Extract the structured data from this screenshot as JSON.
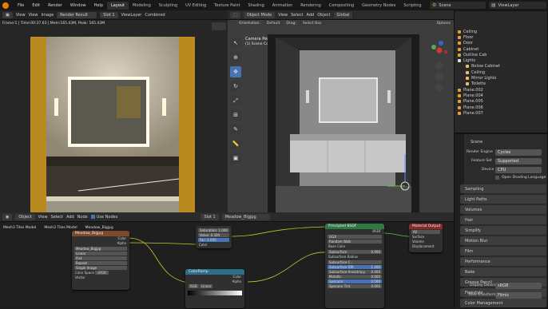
{
  "menu": [
    "File",
    "Edit",
    "Render",
    "Window",
    "Help"
  ],
  "workspaces": [
    "Layout",
    "Modeling",
    "Sculpting",
    "UV Editing",
    "Texture Paint",
    "Shading",
    "Animation",
    "Rendering",
    "Compositing",
    "Geometry Nodes",
    "Scripting"
  ],
  "active_workspace": "Layout",
  "scene": {
    "label": "Scene",
    "view_layer": "ViewLayer"
  },
  "image_editor": {
    "view": "View",
    "view2": "View",
    "image": "Image",
    "name": "Render Result",
    "slot": "Slot 1",
    "layer": "ViewLayer",
    "pass": "Combined",
    "stats": "Frame:1 | Time:00:37.63 | Mem:165.43M, Peak: 165.43M"
  },
  "viewport": {
    "mode": "Object Mode",
    "view": "View",
    "select": "Select",
    "add": "Add",
    "object": "Object",
    "transform": "Global",
    "orientation": "Orientation:",
    "default": "Default",
    "drag": "Drag:",
    "drag_mode": "Select Box",
    "options": "Options",
    "title": "Camera Perspective",
    "subtitle": "(1) Scene Collection | Mesh3 Tiles Model"
  },
  "outliner": {
    "rows": [
      "Ceiling",
      "Floor",
      "Door",
      "Cabinet",
      "Outline Cab",
      "Lights",
      "Below Cabinet",
      "Ceiling",
      "Mirror Lights",
      "Toilette",
      "Plane.002",
      "Plane.004",
      "Plane.005",
      "Plane.006",
      "Plane.007"
    ]
  },
  "properties": {
    "scene": "Scene",
    "render_engine_label": "Render Engine",
    "render_engine": "Cycles",
    "feature_set_label": "Feature Set",
    "feature_set": "Supported",
    "device_label": "Device",
    "device": "CPU",
    "osl": "Open Shading Language",
    "sections": [
      "Sampling",
      "Light Paths",
      "Volumes",
      "Hair",
      "Simplify",
      "Motion Blur",
      "Film",
      "Performance",
      "Bake",
      "Grease Pencil",
      "Freestyle",
      "Color Management"
    ],
    "display_device_label": "Display Device",
    "display_device": "sRGB",
    "view_transform_label": "View Transform",
    "view_transform": "Filmic"
  },
  "node_editor": {
    "type": "Object",
    "view": "View",
    "select": "Select",
    "add": "Add",
    "node": "Node",
    "use_nodes": "Use Nodes",
    "slot": "Slot 1",
    "material": "Meadow_Bigjpg",
    "breadcrumb": [
      "Mesh3 Tiles Model",
      "Mesh3 Tiles Model",
      "Meadow_Bigjpg"
    ]
  },
  "nodes": {
    "image_tex": {
      "title": "Meadow_Bigjpg",
      "out1": "Color",
      "out2": "Alpha",
      "file": "Meadow_Bigjpg",
      "rows": [
        "Linear",
        "Flat",
        "Repeat",
        "Single Image"
      ],
      "cs_label": "Color Space",
      "cs": "sRGB",
      "vec": "Vector"
    },
    "hsv": {
      "rows": [
        "Saturation: 1.000",
        "Value: 0.300",
        "Fac: 1.000"
      ],
      "out": "Color"
    },
    "colorramp": {
      "title": "ColorRamp",
      "outs": [
        "Color",
        "Alpha"
      ],
      "mode": "RGB",
      "interp": "Linear"
    },
    "bsdf": {
      "title": "Principled BSDF",
      "out": "BSDF",
      "dist": "GGX",
      "ss": "Random Walk",
      "rows": [
        "Base Color",
        "Subsurface",
        "Subsurface Radius",
        "Subsurface C..",
        "Subsurface IOR",
        "Subsurface Anisotropy",
        "Metallic",
        "Specular",
        "Specular Tint"
      ],
      "vals": [
        "",
        "0.000",
        "",
        "",
        "1.400",
        "0.000",
        "0.000",
        "0.500",
        "0.000"
      ]
    },
    "output": {
      "title": "Material Output",
      "target": "All",
      "rows": [
        "Surface",
        "Volume",
        "Displacement"
      ]
    }
  }
}
